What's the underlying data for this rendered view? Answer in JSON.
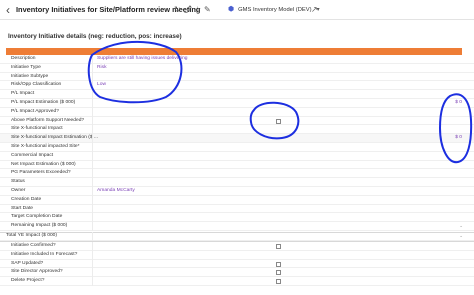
{
  "header": {
    "title": "Inventory Initiatives for Site/Platform review meeting",
    "model": "GMS Inventory Model (DEV)"
  },
  "section": {
    "title": "Inventory Initiative details (neg: reduction, pos: increase)"
  },
  "rows": [
    {
      "label": "Description",
      "value": "Suppliers are still having issues delivering"
    },
    {
      "label": "Initiative Type",
      "value": "Risk"
    },
    {
      "label": "Initiative Subtype",
      "value": ""
    },
    {
      "label": "Risk/Opp Classification",
      "value": "Low"
    },
    {
      "label": "P/L Impact",
      "value": ""
    },
    {
      "label": "P/L Impact Estimation ($ 000)",
      "value": "$ 0"
    },
    {
      "label": "P/L Impact Approved?",
      "value": ""
    },
    {
      "label": "Above Platform Support Needed?",
      "value": ""
    },
    {
      "label": "Site X-functional Impact",
      "value": ""
    },
    {
      "label": "Site X-functional Impact Estimation ($ ...",
      "value": "$ 0"
    },
    {
      "label": "Site X-functional impacted Site*",
      "value": ""
    },
    {
      "label": "Commercial Impact",
      "value": ""
    },
    {
      "label": "Net Impact Estimation ($ 000)",
      "value": ""
    },
    {
      "label": "PG Parameters Exceeded?",
      "value": ""
    },
    {
      "label": "Status",
      "value": ""
    },
    {
      "label": "Owner",
      "value": "Amanda McCarty"
    },
    {
      "label": "Creation Date",
      "value": ""
    },
    {
      "label": "Start Date",
      "value": ""
    },
    {
      "label": "Target Completion Date",
      "value": ""
    },
    {
      "label": "Remaining Impact ($ 000)",
      "value": ""
    },
    {
      "label": "Total YE Impact ($ 000)",
      "value": ""
    },
    {
      "label": "Initiative Confirmed?",
      "value": ""
    },
    {
      "label": "Initiative Included In Forecast?",
      "value": ""
    },
    {
      "label": "SAP Updated?",
      "value": ""
    },
    {
      "label": "Site Director Approved?",
      "value": ""
    },
    {
      "label": "Delete Project?",
      "value": ""
    }
  ]
}
